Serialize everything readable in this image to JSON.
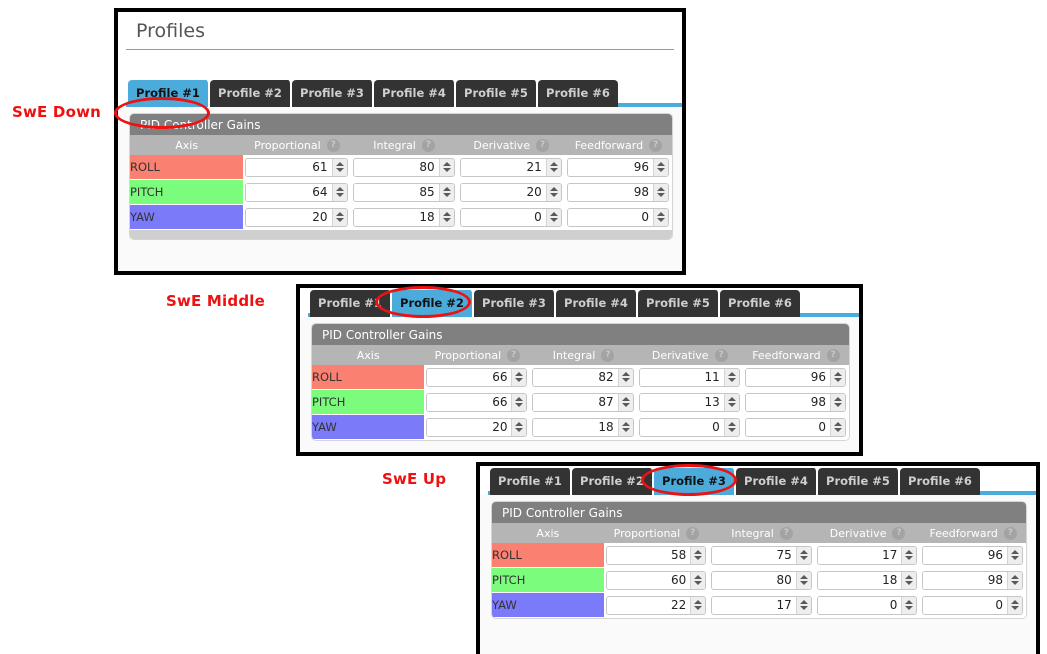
{
  "annotations": [
    {
      "label": "SwE Down"
    },
    {
      "label": "SwE Middle"
    },
    {
      "label": "SwE Up"
    }
  ],
  "page": {
    "title": "Profiles"
  },
  "colors": {
    "accent": "#4bacdc",
    "tab_inactive_bg": "#333333",
    "group_header_bg": "#808080",
    "table_header_bg": "#b5b5b5",
    "annotation_red": "#ee1111",
    "roll": "#fa8072",
    "pitch": "#7cfc7c",
    "yaw": "#7b7bfa"
  },
  "tabs": [
    "Profile #1",
    "Profile #2",
    "Profile #3",
    "Profile #4",
    "Profile #5",
    "Profile #6"
  ],
  "group": {
    "title": "PID Controller Gains"
  },
  "table": {
    "columns": [
      "Axis",
      "Proportional",
      "Integral",
      "Derivative",
      "Feedforward"
    ],
    "help_icon": "?",
    "help_icon_name": "help-circle-icon",
    "axes": [
      "ROLL",
      "PITCH",
      "YAW"
    ]
  },
  "panels": [
    {
      "name": "swe-down",
      "annotation": "SwE Down",
      "active_tab": 0,
      "show_page_title": true,
      "rows": [
        {
          "axis": "ROLL",
          "proportional": "61",
          "integral": "80",
          "derivative": "21",
          "feedforward": "96"
        },
        {
          "axis": "PITCH",
          "proportional": "64",
          "integral": "85",
          "derivative": "20",
          "feedforward": "98"
        },
        {
          "axis": "YAW",
          "proportional": "20",
          "integral": "18",
          "derivative": "0",
          "feedforward": "0"
        }
      ]
    },
    {
      "name": "swe-middle",
      "annotation": "SwE Middle",
      "active_tab": 1,
      "show_page_title": false,
      "rows": [
        {
          "axis": "ROLL",
          "proportional": "66",
          "integral": "82",
          "derivative": "11",
          "feedforward": "96"
        },
        {
          "axis": "PITCH",
          "proportional": "66",
          "integral": "87",
          "derivative": "13",
          "feedforward": "98"
        },
        {
          "axis": "YAW",
          "proportional": "20",
          "integral": "18",
          "derivative": "0",
          "feedforward": "0"
        }
      ]
    },
    {
      "name": "swe-up",
      "annotation": "SwE Up",
      "active_tab": 2,
      "show_page_title": false,
      "rows": [
        {
          "axis": "ROLL",
          "proportional": "58",
          "integral": "75",
          "derivative": "17",
          "feedforward": "96"
        },
        {
          "axis": "PITCH",
          "proportional": "60",
          "integral": "80",
          "derivative": "18",
          "feedforward": "98"
        },
        {
          "axis": "YAW",
          "proportional": "22",
          "integral": "17",
          "derivative": "0",
          "feedforward": "0"
        }
      ]
    }
  ]
}
